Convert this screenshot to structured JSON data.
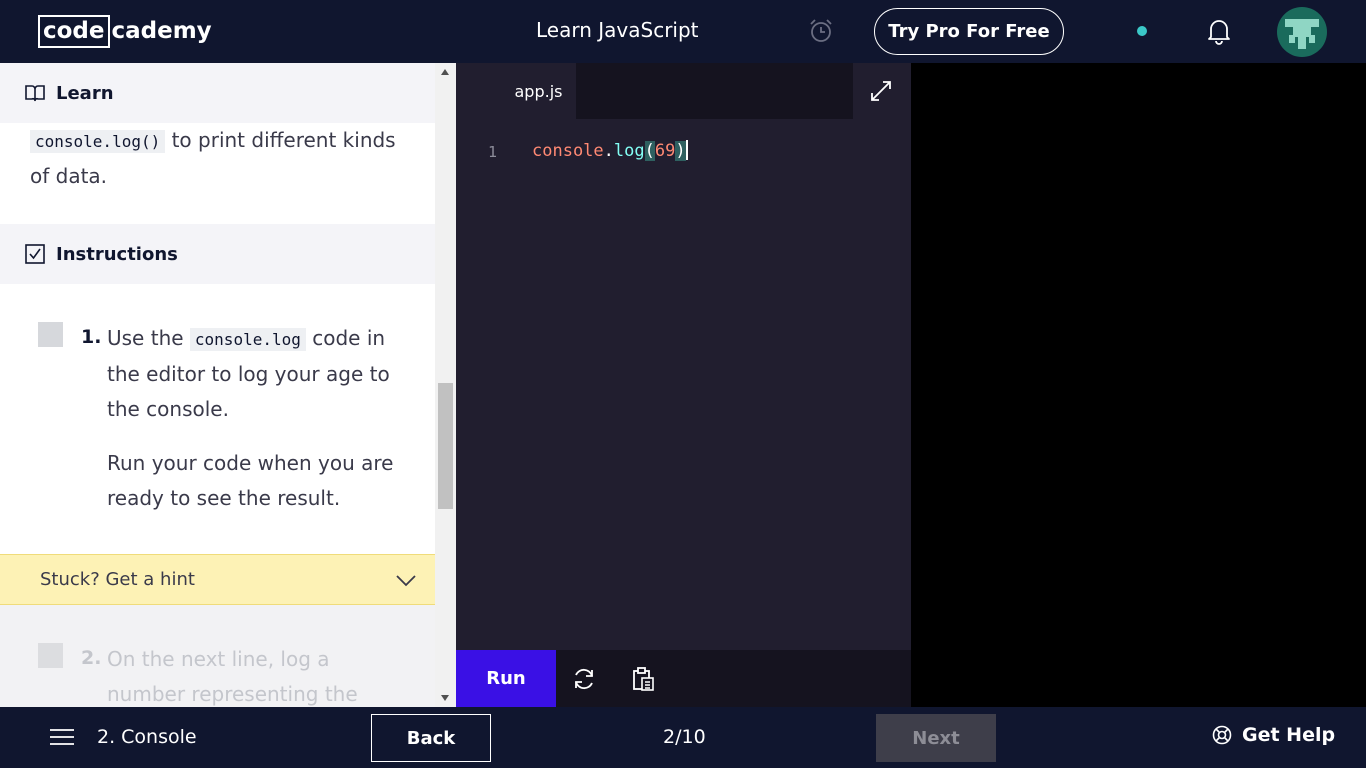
{
  "header": {
    "logo_boxed": "code",
    "logo_rest": "cademy",
    "course_title": "Learn JavaScript",
    "pro_button": "Try Pro For Free",
    "status_dot_color": "#3bc8c8"
  },
  "learn": {
    "heading": "Learn",
    "code_snippet": "console.log()",
    "text_after": " to print different kinds of data."
  },
  "instructions": {
    "heading": "Instructions",
    "steps": [
      {
        "number": "1.",
        "text_before": "Use the ",
        "code": "console.log",
        "text_after": " code in the editor to log your age to the console.",
        "followup": "Run your code when you are ready to see the result."
      },
      {
        "number": "2.",
        "text": "On the next line, log a number representing the"
      }
    ],
    "hint_label": "Stuck? Get a hint"
  },
  "editor": {
    "tab_name": "app.js",
    "line_number": "1",
    "code": {
      "object": "console",
      "dot": ".",
      "method": "log",
      "open": "(",
      "arg": "69",
      "close": ")"
    },
    "run_label": "Run"
  },
  "footer": {
    "lesson_name": "2. Console",
    "back_label": "Back",
    "progress": "2/10",
    "next_label": "Next",
    "help_label": "Get Help"
  },
  "colors": {
    "nav_bg": "#10162f",
    "run_button": "#3a10e5",
    "hint_bg": "#fdf2b5"
  }
}
